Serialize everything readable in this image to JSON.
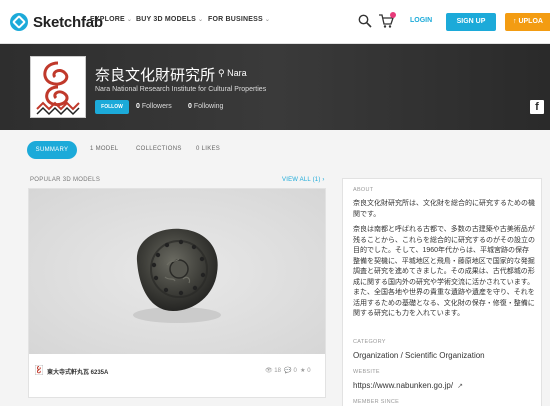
{
  "nav": {
    "brand": "Sketchfab",
    "explore": "EXPLORE",
    "buy": "BUY 3D MODELS",
    "business": "FOR BUSINESS",
    "login": "LOGIN",
    "signup": "SIGN UP",
    "upload": "UPLOA"
  },
  "profile": {
    "name": "奈良文化財研究所",
    "location": "Nara",
    "subtitle": "Nara National Research Institute for Cultural Properties",
    "follow": "FOLLOW",
    "followers_count": "0",
    "followers_label": "Followers",
    "following_count": "0",
    "following_label": "Following"
  },
  "tabs": {
    "summary": "SUMMARY",
    "model": "1 MODEL",
    "collections": "COLLECTIONS",
    "likes": "0 LIKES"
  },
  "popular": {
    "label": "POPULAR 3D MODELS",
    "see_all": "VIEW ALL (1) ›",
    "model_title": "東大寺式軒丸瓦 6235A",
    "views": "18",
    "comments": "0",
    "likes": "0"
  },
  "about": {
    "label": "ABOUT",
    "para1": "奈良文化財研究所は、文化財を総合的に研究するための機関です。",
    "para2": "奈良は南都と呼ばれる古都で、多数の古建築や古美術品が残ることから、これらを総合的に研究するのがその設立の目的でした。そして、1960年代からは、平城宮跡の保存整備を契機に、平城地区と飛鳥・藤原地区で国家的な発掘調査と研究を進めてきました。その成果は、古代都城の形成に関する国内外の研究や学術交流に活かされています。また、全国各地や世界の貴重な遺跡や遺産を守り、それを活用するための基礎となる、文化財の保存・修復・整備に関する研究にも力を入れています。",
    "category_label": "CATEGORY",
    "category": "Organization / Scientific Organization",
    "website_label": "WEBSITE",
    "website": "https://www.nabunken.go.jp/",
    "member_label": "MEMBER SINCE"
  },
  "colors": {
    "accent": "#1caad9",
    "upload": "#f39c12",
    "banner": "#2b2b2b"
  }
}
